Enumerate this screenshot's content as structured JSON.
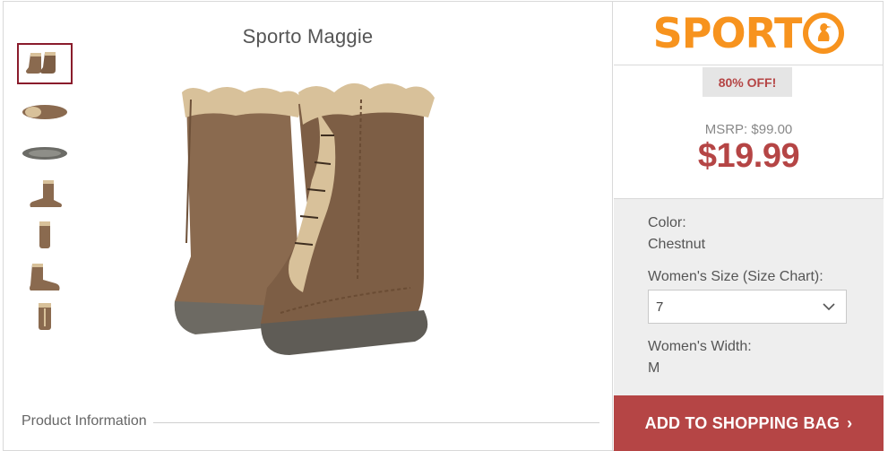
{
  "product": {
    "title": "Sporto Maggie",
    "info_label": "Product Information"
  },
  "thumbnails": [
    {
      "name": "thumb-pair",
      "active": true
    },
    {
      "name": "thumb-top"
    },
    {
      "name": "thumb-sole"
    },
    {
      "name": "thumb-side"
    },
    {
      "name": "thumb-back"
    },
    {
      "name": "thumb-side-2"
    },
    {
      "name": "thumb-front"
    }
  ],
  "brand": {
    "text_left": "SPORT",
    "accent_color": "#f7931e"
  },
  "pricing": {
    "discount_badge": "80% OFF!",
    "msrp": "MSRP: $99.00",
    "price": "$19.99",
    "price_color": "#b54545"
  },
  "options": {
    "color_label": "Color:",
    "color_value": "Chestnut",
    "size_label": "Women's Size (Size Chart):",
    "size_value": "7",
    "width_label": "Women's Width:",
    "width_value": "M"
  },
  "cta": {
    "label": "ADD TO SHOPPING BAG",
    "chevron": "›"
  }
}
